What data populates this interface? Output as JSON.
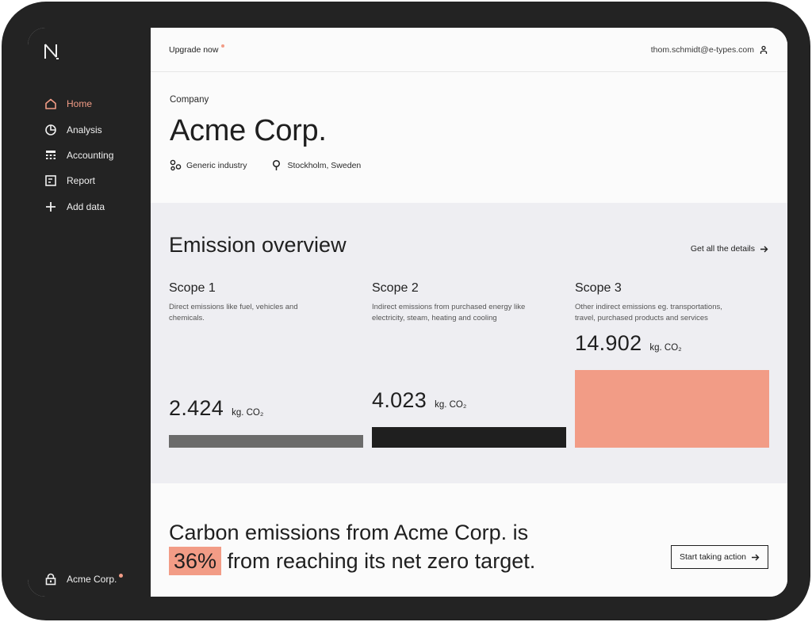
{
  "sidebar": {
    "logo": "N",
    "items": [
      {
        "label": "Home",
        "icon": "home-icon",
        "active": true
      },
      {
        "label": "Analysis",
        "icon": "pie-chart-icon"
      },
      {
        "label": "Accounting",
        "icon": "calculator-icon"
      },
      {
        "label": "Report",
        "icon": "report-icon"
      },
      {
        "label": "Add data",
        "icon": "plus-icon"
      }
    ],
    "org": {
      "label": "Acme Corp.",
      "icon": "lock-icon"
    }
  },
  "header": {
    "upgrade": "Upgrade now",
    "user": "thom.schmidt@e-types.com"
  },
  "company": {
    "label": "Company",
    "name": "Acme Corp.",
    "industry": "Generic industry",
    "location": "Stockholm, Sweden"
  },
  "emissions": {
    "title": "Emission overview",
    "details_link": "Get all the details",
    "scopes": [
      {
        "name": "Scope 1",
        "description": "Direct emissions like fuel, vehicles and chemicals.",
        "value": "2.424",
        "unit": "kg. CO₂",
        "color": "#6b6b6b"
      },
      {
        "name": "Scope 2",
        "description": "Indirect emissions from purchased energy like electricity, steam, heating and cooling",
        "value": "4.023",
        "unit": "kg. CO₂",
        "color": "#1f1f1f"
      },
      {
        "name": "Scope 3",
        "description": "Other indirect emissions eg. transportations, travel, purchased products and services",
        "value": "14.902",
        "unit": "kg. CO₂",
        "color": "#f29c86"
      }
    ]
  },
  "target": {
    "line1": "Carbon emissions from Acme Corp. is",
    "percent": "36%",
    "line2": " from reaching its net zero target.",
    "button": "Start taking action"
  },
  "colors": {
    "accent": "#f29c86",
    "sidebar": "#232323"
  }
}
